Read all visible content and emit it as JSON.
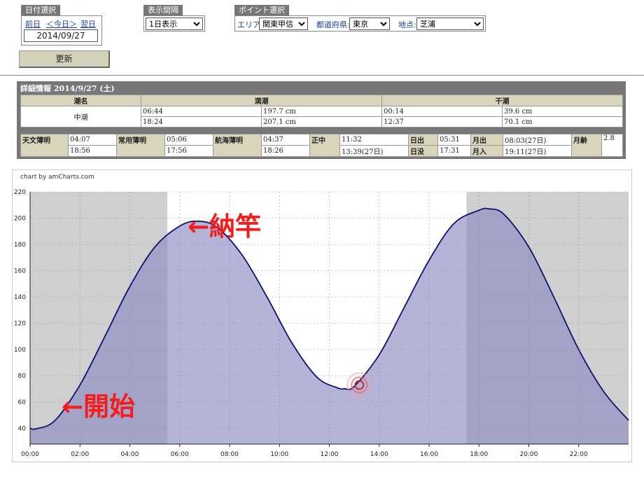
{
  "date_panel": {
    "title": "日付選択",
    "prev": "前日",
    "today": "＜今日＞",
    "next": "翌日",
    "date": "2014/09/27"
  },
  "interval_panel": {
    "title": "表示間隔",
    "selected": "1日表示"
  },
  "point_panel": {
    "title": "ポイント選択",
    "area_label": "エリア:",
    "area_value": "関東甲信",
    "pref_label": "都道府県:",
    "pref_value": "東京",
    "place_label": "地点:",
    "place_value": "芝浦"
  },
  "update_button": "更新",
  "detail": {
    "title": "詳細情報 2014/9/27 (土)",
    "tide_header": "潮名",
    "high_header": "満潮",
    "low_header": "干潮",
    "tide_name": "中潮",
    "high_rows": [
      {
        "time": "06:44",
        "level": "197.7 cm"
      },
      {
        "time": "18:24",
        "level": "207.1 cm"
      }
    ],
    "low_rows": [
      {
        "time": "00:14",
        "level": "39.6 cm"
      },
      {
        "time": "12:37",
        "level": "70.1 cm"
      }
    ],
    "astro_label": "天文薄明",
    "astro_values": [
      "04:07",
      "18:56"
    ],
    "civil_label": "常用薄明",
    "civil_values": [
      "05:06",
      "17:56"
    ],
    "nautical_label": "航海薄明",
    "nautical_values": [
      "04:37",
      "18:26"
    ],
    "noon_label": "正中",
    "noon_values": [
      "11:32",
      "13:39(27日)"
    ],
    "sunrise_label": "日出",
    "sunrise_value": "05:31",
    "sunset_label": "日没",
    "sunset_value": "17:31",
    "moonrise_label": "月出",
    "moonrise_value": "08:03(27日)",
    "moonset_label": "月入",
    "moonset_value": "19:11(27日)",
    "moonage_label": "月齢",
    "moonage_value": "2.8"
  },
  "chart_credit": "chart by amCharts.com",
  "annotations": {
    "end": "←納竿",
    "start": "←開始"
  },
  "chart_data": {
    "type": "area",
    "x_unit": "hour",
    "x_ticks": [
      "00:00",
      "02:00",
      "04:00",
      "06:00",
      "08:00",
      "10:00",
      "12:00",
      "14:00",
      "16:00",
      "18:00",
      "20:00",
      "22:00"
    ],
    "y_ticks": [
      40,
      60,
      80,
      100,
      120,
      140,
      160,
      180,
      200,
      220
    ],
    "ylim": [
      28,
      220
    ],
    "xlim": [
      0,
      24
    ],
    "night_bands": [
      [
        0,
        5.5
      ],
      [
        17.5,
        24
      ]
    ],
    "highlight_band": [
      0,
      13.2
    ],
    "series": [
      {
        "x": [
          0,
          0.24,
          1,
          2,
          3,
          4,
          5,
          6,
          6.73,
          7.5,
          8.5,
          9.5,
          10.5,
          11.5,
          12.3,
          12.62,
          13,
          14,
          15,
          16,
          17,
          18,
          18.4,
          19,
          20,
          21,
          22,
          23,
          24
        ],
        "y": [
          40,
          39.6,
          46,
          73,
          110,
          148,
          178,
          194,
          197.7,
          193,
          172,
          140,
          105,
          79,
          71,
          70.1,
          72,
          96,
          132,
          168,
          196,
          206,
          207.1,
          203,
          178,
          140,
          100,
          68,
          46
        ]
      }
    ],
    "marker": {
      "x": 13.2,
      "y": 73
    },
    "colors": {
      "line": "#10106e",
      "fill": "#8c8cc4",
      "night": "#cfcfcf",
      "highlight": "#6a6a8a"
    }
  }
}
